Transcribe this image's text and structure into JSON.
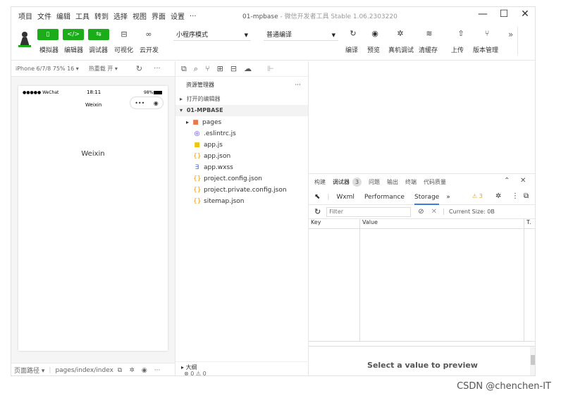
{
  "menu": [
    "项目",
    "文件",
    "编辑",
    "工具",
    "转到",
    "选择",
    "视图",
    "界面",
    "设置",
    "..."
  ],
  "window": {
    "project": "01-mpbase",
    "title": "- 微信开发者工具 Stable 1.06.2303220"
  },
  "toolbar": {
    "left_buttons": [
      {
        "label": "模拟器",
        "icon": "▯"
      },
      {
        "label": "编辑器",
        "icon": "</>"
      },
      {
        "label": "调试器",
        "icon": "⇆"
      },
      {
        "label": "可视化",
        "icon": "⊟"
      },
      {
        "label": "云开发",
        "icon": "∞"
      }
    ],
    "mode_select": "小程序模式",
    "compile_select": "普通编译",
    "right_buttons": [
      {
        "label": "编译",
        "icon": "↻"
      },
      {
        "label": "预览",
        "icon": "◉"
      },
      {
        "label": "真机调试",
        "icon": "✲"
      },
      {
        "label": "清缓存",
        "icon": "≋"
      },
      {
        "label": "上传",
        "icon": "⇧"
      },
      {
        "label": "版本管理",
        "icon": "⑂"
      }
    ],
    "more": "»"
  },
  "simulator": {
    "device": "iPhone 6/7/8 75% 16 ▾",
    "hot_reload": "热重载 开 ▾",
    "status_carrier": "●●●●● WeChat",
    "status_time": "18:11",
    "status_battery": "98%",
    "nav_title": "Weixin",
    "body_text": "Weixin",
    "footer_path_label": "页面路径 ▾",
    "footer_path": "pages/index/index"
  },
  "explorer": {
    "title": "资源管理器",
    "more": "···",
    "open_editors": "打开的编辑器",
    "project": "01-MPBASE",
    "files": [
      {
        "name": "pages",
        "icon": "folder-icon",
        "color": "#e8794a",
        "glyph": "■",
        "arrow": "▸"
      },
      {
        "name": ".eslintrc.js",
        "icon": "eslint-icon",
        "color": "#4b32c3",
        "glyph": "◎",
        "arrow": ""
      },
      {
        "name": "app.js",
        "icon": "js-file-icon",
        "color": "#f1c40f",
        "glyph": "■",
        "arrow": ""
      },
      {
        "name": "app.json",
        "icon": "json-file-icon",
        "color": "#e8a317",
        "glyph": "{}",
        "arrow": ""
      },
      {
        "name": "app.wxss",
        "icon": "wxss-file-icon",
        "color": "#3f6ad8",
        "glyph": "∃",
        "arrow": ""
      },
      {
        "name": "project.config.json",
        "icon": "json-file-icon",
        "color": "#e8a317",
        "glyph": "{}",
        "arrow": ""
      },
      {
        "name": "project.private.config.json",
        "icon": "json-file-icon",
        "color": "#e8a317",
        "glyph": "{}",
        "arrow": ""
      },
      {
        "name": "sitemap.json",
        "icon": "json-file-icon",
        "color": "#e8a317",
        "glyph": "{}",
        "arrow": ""
      }
    ],
    "outline": "大纲",
    "problems": "⊗ 0 ⚠ 0"
  },
  "devtools": {
    "top_tabs": [
      "构建",
      "调试器",
      "问题",
      "输出",
      "终端",
      "代码质量"
    ],
    "active_top_tab": "调试器",
    "badge": "3",
    "sub_tabs": [
      "Wxml",
      "Performance",
      "Storage"
    ],
    "active_sub_tab": "Storage",
    "sub_more": "»",
    "warn": "⚠ 3",
    "filter_placeholder": "Filter",
    "current_size": "Current Size: 0B",
    "columns": [
      "Key",
      "Value",
      "T."
    ],
    "preview": "Select a value to preview"
  },
  "watermark": "CSDN @chenchen-IT"
}
